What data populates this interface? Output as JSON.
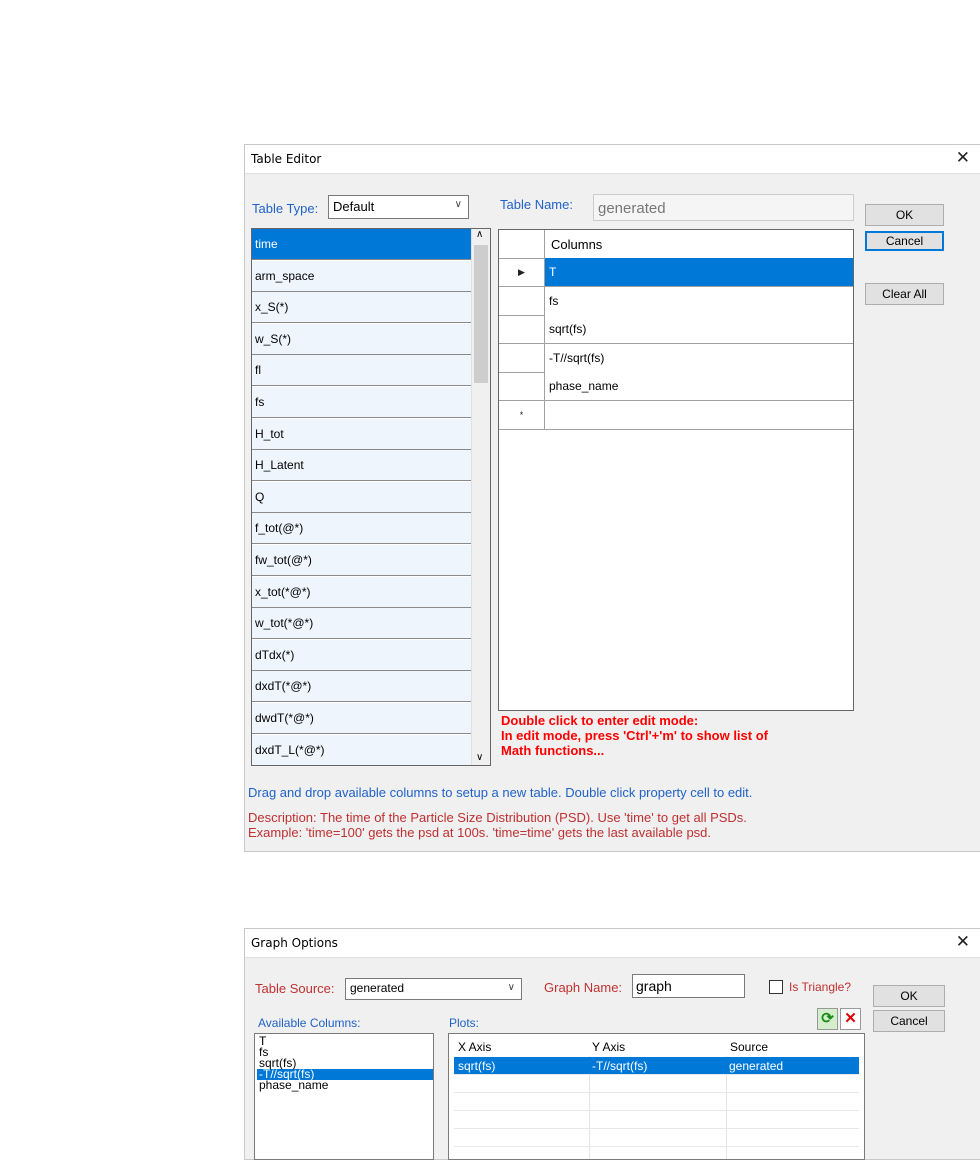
{
  "table_editor": {
    "title": "Table Editor",
    "close_glyph": "✕",
    "table_type_label": "Table Type:",
    "table_type_value": "Default",
    "table_name_label": "Table Name:",
    "table_name_value": "generated",
    "ok_label": "OK",
    "cancel_label": "Cancel",
    "clear_all_label": "Clear All",
    "available_items": [
      "time",
      "arm_space",
      "x_S(*)",
      "w_S(*)",
      "fl",
      "fs",
      "H_tot",
      "H_Latent",
      "Q",
      "f_tot(@*)",
      "fw_tot(@*)",
      "x_tot(*@*)",
      "w_tot(*@*)",
      "dTdx(*)",
      "dxdT(*@*)",
      "dwdT(*@*)",
      "dxdT_L(*@*)"
    ],
    "columns_header": "Columns",
    "columns": [
      "T",
      "fs",
      "sqrt(fs)",
      "-T//sqrt(fs)",
      "phase_name",
      ""
    ],
    "current_row_marker": "▶",
    "new_row_marker": "*",
    "edit_hint_lines": [
      "Double click to enter edit mode:",
      "In edit mode, press 'Ctrl'+'m' to show list of",
      "Math functions..."
    ],
    "drag_hint": "Drag and drop available columns to setup a new table. Double click property cell to edit.",
    "description_line1": "Description: The time of the Particle Size Distribution (PSD). Use 'time' to get all PSDs.",
    "description_line2": "Example: 'time=100' gets the psd at 100s. 'time=time' gets the last available psd."
  },
  "graph_options": {
    "title": "Graph Options",
    "close_glyph": "✕",
    "table_source_label": "Table Source:",
    "table_source_value": "generated",
    "graph_name_label": "Graph Name:",
    "graph_name_value": "graph",
    "is_triangle_label": "Is Triangle?",
    "ok_label": "OK",
    "cancel_label": "Cancel",
    "available_columns_label": "Available Columns:",
    "available_columns": [
      "T",
      "fs",
      "sqrt(fs)",
      "-T//sqrt(fs)",
      "phase_name"
    ],
    "selected_available_index": 3,
    "plots_label": "Plots:",
    "plots_headers": [
      "X Axis",
      "Y Axis",
      "Source"
    ],
    "plots_rows": [
      [
        "sqrt(fs)",
        "-T//sqrt(fs)",
        "generated"
      ]
    ],
    "refresh_icon_glyph": "⟳",
    "delete_icon_glyph": "✕"
  }
}
